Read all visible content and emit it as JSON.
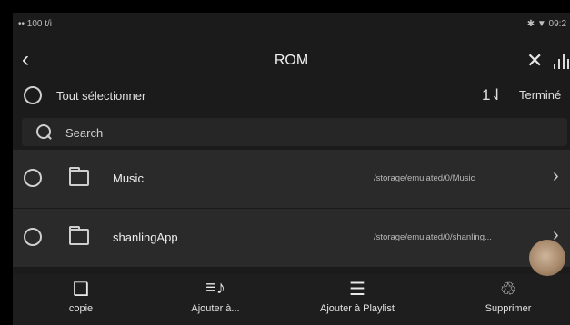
{
  "status_bar": {
    "left": "•• 100 t/i",
    "right": "✱ ▼ 09:2"
  },
  "header": {
    "title": "ROM",
    "back_icon": "‹",
    "close_icon": "✕",
    "eq_icon": "equalizer-icon"
  },
  "select_bar": {
    "select_all_label": "Tout sélectionner",
    "sort_icon": "1⇃",
    "done_label": "Terminé"
  },
  "search": {
    "placeholder": "Search"
  },
  "files": [
    {
      "name": "Music",
      "path": "/storage/emulated/0/Music"
    },
    {
      "name": "shanlingApp",
      "path": "/storage/emulated/0/shanling..."
    }
  ],
  "toolbar": [
    {
      "label": "copie",
      "icon": "❑"
    },
    {
      "label": "Ajouter à...",
      "icon": "≡♪"
    },
    {
      "label": "Ajouter à Playlist",
      "icon": "☰"
    },
    {
      "label": "Supprimer",
      "icon": "♲"
    }
  ],
  "colors": {
    "background": "#1b1b1b",
    "row": "#2a2a2a",
    "text": "#e8e8e8"
  }
}
